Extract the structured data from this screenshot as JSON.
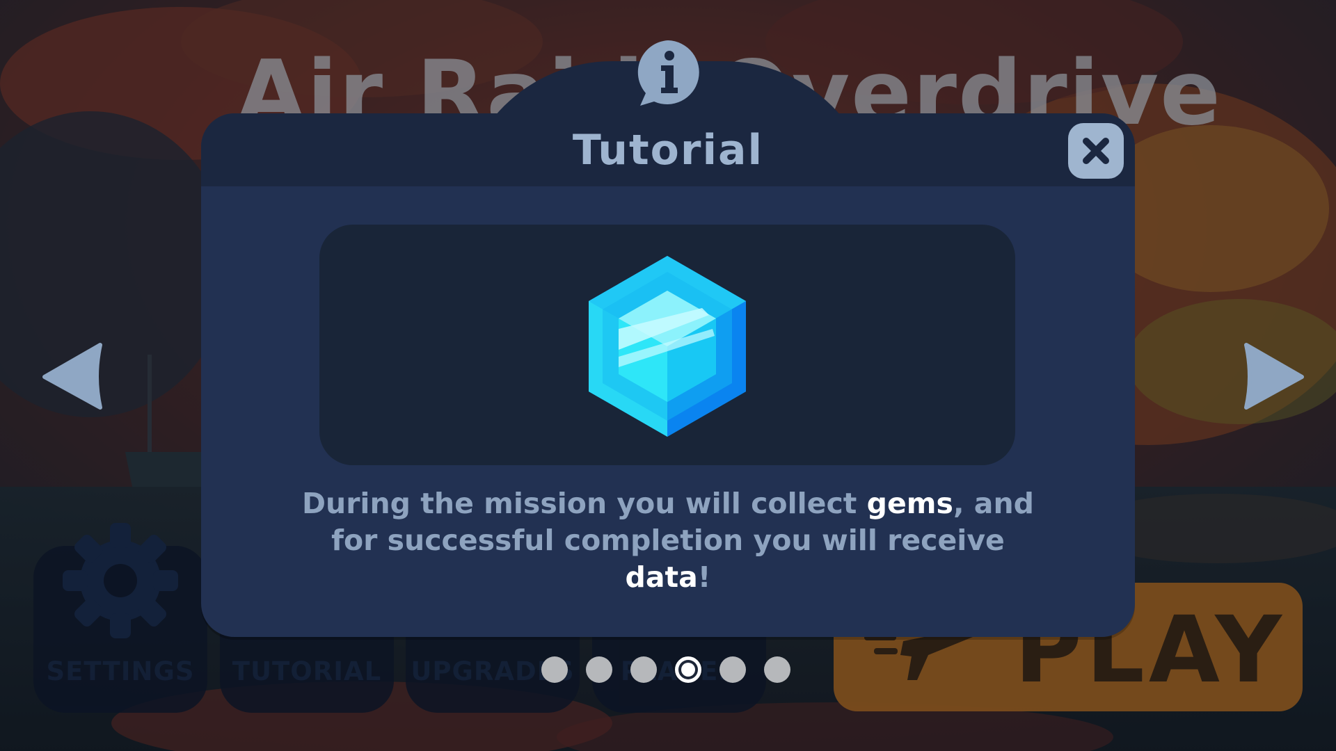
{
  "game": {
    "title": "Air Raid: Overdrive"
  },
  "menu": {
    "settings_label": "SETTINGS",
    "tutorial_label": "TUTORIAL",
    "upgrades_label": "UPGRADES",
    "planes_label": "PLANES",
    "play_label": "PLAY"
  },
  "tutorial": {
    "title": "Tutorial",
    "text_part1": "During the mission you will collect ",
    "text_gems": "gems",
    "text_part2": ", and for successful completion you will receive ",
    "text_data": "data",
    "text_part3": "!",
    "page_count": 6,
    "current_page": 4
  },
  "icons": {
    "info": "info-icon",
    "close": "close-icon",
    "prev": "arrow-left-icon",
    "next": "arrow-right-icon",
    "gem": "gem-icon",
    "settings": "gear-icon",
    "play": "plane-icon"
  },
  "colors": {
    "modal_bg": "#223152",
    "modal_header": "#1b2740",
    "title_text": "#9eb4cf",
    "body_text": "#8ea3bf",
    "highlight_text": "#ffffff",
    "gem": "#19c8f0",
    "play_button": "#7a4c1c"
  }
}
